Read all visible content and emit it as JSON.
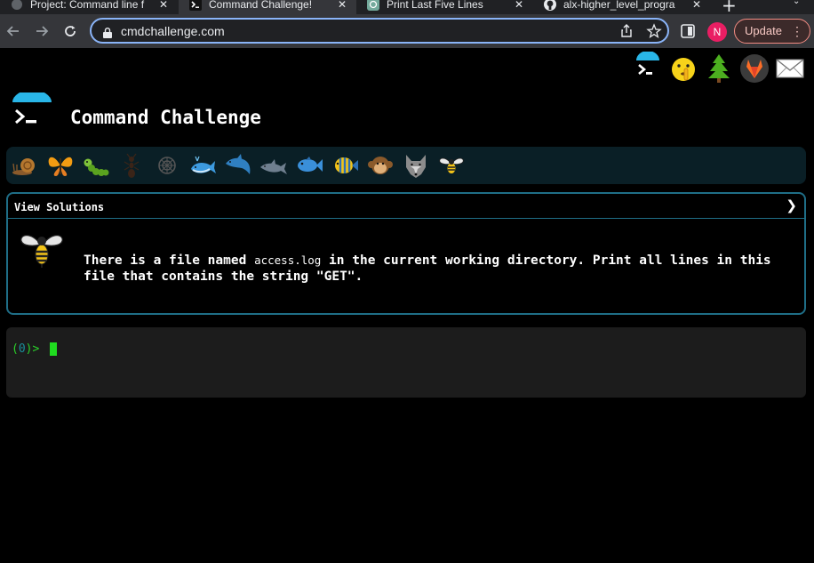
{
  "browser": {
    "tabs": [
      {
        "title": "Project: Command line f",
        "active": false,
        "favicon": "project-favicon"
      },
      {
        "title": "Command Challenge!",
        "active": true,
        "favicon": "terminal-favicon"
      },
      {
        "title": "Print Last Five Lines",
        "active": false,
        "favicon": "chatgpt-favicon"
      },
      {
        "title": "alx-higher_level_progra",
        "active": false,
        "favicon": "github-favicon"
      }
    ],
    "url": "cmdchallenge.com",
    "profile_initial": "N",
    "update_label": "Update",
    "accent": "#8ab4f8"
  },
  "header": {
    "title": "Command Challenge",
    "top_icons": [
      "cmdchallenge-icon",
      "shush-emoji-icon",
      "tree-icon",
      "gitlab-icon",
      "envelope-icon"
    ]
  },
  "levels": [
    "snail",
    "butterfly",
    "caterpillar",
    "ant",
    "shell",
    "whale",
    "dolphin",
    "dolphin-small",
    "fish",
    "tropical-fish",
    "monkey",
    "wolf",
    "bee"
  ],
  "challenge": {
    "solutions_label": "View Solutions",
    "text_before": "There is a file named ",
    "code": "access.log",
    "text_after": " in the current working directory. Print all lines in this file that contains the string \"GET\"."
  },
  "terminal": {
    "prompt_open": "(",
    "exit_code": "0",
    "prompt_close": ")>",
    "cursor_color": "#1fdc1f"
  }
}
